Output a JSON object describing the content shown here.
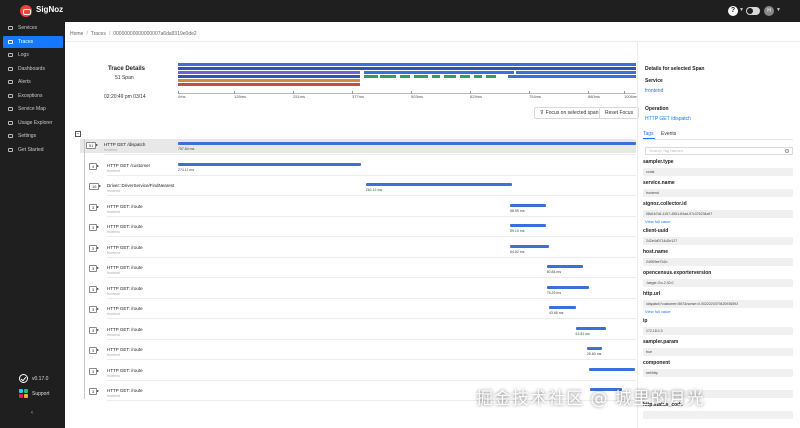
{
  "app": {
    "name": "SigNoz",
    "avatar_initials": "H"
  },
  "sidebar": {
    "items": [
      {
        "label": "Services"
      },
      {
        "label": "Traces",
        "active": true
      },
      {
        "label": "Logs"
      },
      {
        "label": "Dashboards"
      },
      {
        "label": "Alerts"
      },
      {
        "label": "Exceptions"
      },
      {
        "label": "Service Map"
      },
      {
        "label": "Usage Explorer"
      },
      {
        "label": "Settings"
      },
      {
        "label": "Get Started"
      }
    ],
    "version": "v0.17.0",
    "support": "Support"
  },
  "breadcrumb": [
    "Home",
    "Traces",
    "00000000000000007a6da9319e0de2"
  ],
  "trace": {
    "title": "Trace Details",
    "span_count": "51 Span",
    "start_time": "02:20:49 pm 03/14",
    "ticks": [
      "0ms",
      "126ms",
      "251ms",
      "377ms",
      "503ms",
      "629ms",
      "754ms",
      "880ms",
      "1006ms",
      "1.13s"
    ],
    "focus_button": "Focus on selected span",
    "reset_button": "Reset Focus",
    "rows": [
      {
        "count": "51",
        "name": "HTTP GET /dispatch",
        "service": "frontend",
        "duration": "757.84 ms",
        "start": 0,
        "width": 1.0
      },
      {
        "count": "4",
        "name": "HTTP GET /customer",
        "service": "frontend",
        "duration": "274.11 ms",
        "start": 0,
        "width": 0.4
      },
      {
        "count": "16",
        "name": "Driver::DriverService/FindNearest",
        "service": "frontend",
        "duration": "262.12 ms",
        "start": 0.41,
        "width": 0.32
      },
      {
        "count": "3",
        "name": "HTTP GET: /route",
        "service": "frontend",
        "duration": "58.95 ms",
        "start": 0.725,
        "width": 0.078
      },
      {
        "count": "3",
        "name": "HTTP GET: /route",
        "service": "frontend",
        "duration": "59.10 ms",
        "start": 0.725,
        "width": 0.078
      },
      {
        "count": "3",
        "name": "HTTP GET: /route",
        "service": "frontend",
        "duration": "64.62 ms",
        "start": 0.725,
        "width": 0.085
      },
      {
        "count": "3",
        "name": "HTTP GET: /route",
        "service": "frontend",
        "duration": "60.84 ms",
        "start": 0.805,
        "width": 0.08
      },
      {
        "count": "3",
        "name": "HTTP GET: /route",
        "service": "frontend",
        "duration": "75.29 ms",
        "start": 0.805,
        "width": 0.093
      },
      {
        "count": "3",
        "name": "HTTP GET: /route",
        "service": "frontend",
        "duration": "43.68 ms",
        "start": 0.81,
        "width": 0.058
      },
      {
        "count": "3",
        "name": "HTTP GET: /route",
        "service": "frontend",
        "duration": "61.81 ms",
        "start": 0.868,
        "width": 0.066
      },
      {
        "count": "3",
        "name": "HTTP GET: /route",
        "service": "frontend",
        "duration": "25.60 ms",
        "start": 0.893,
        "width": 0.033
      },
      {
        "count": "3",
        "name": "HTTP GET: /route",
        "service": "frontend",
        "duration": "",
        "start": 0.898,
        "width": 0.1
      },
      {
        "count": "3",
        "name": "HTTP GET: /route",
        "service": "frontend",
        "duration": "",
        "start": 0.9,
        "width": 0.07
      }
    ]
  },
  "details": {
    "title": "Details for selected Span",
    "service_label": "Service",
    "service_value": "frontend",
    "operation_label": "Operation",
    "operation_value": "HTTP GET /dispatch",
    "tabs": [
      "Tags",
      "Events"
    ],
    "search_placeholder": "Search Tag Names",
    "view_full": "View full value",
    "tags": [
      {
        "key": "sampler.type",
        "value": "const"
      },
      {
        "key": "service.name",
        "value": "frontend"
      },
      {
        "key": "signoz.collector.id",
        "value": "08d1b7c6-1157-4551-84ad-97c376234a97",
        "more": true
      },
      {
        "key": "client-uuid",
        "value": "242e4d0714d2e127"
      },
      {
        "key": "host.name",
        "value": "249f2fee7b1b"
      },
      {
        "key": "opencensus.exporterversion",
        "value": "Jaeger-Go-2.30.0"
      },
      {
        "key": "http.url",
        "value": "/dispatch?customer=567&nonse=0.0022220379420936593",
        "more": true
      },
      {
        "key": "ip",
        "value": "172.18.0.3"
      },
      {
        "key": "sampler.param",
        "value": "true"
      },
      {
        "key": "component",
        "value": "net/http"
      },
      {
        "key": "",
        "value": ""
      },
      {
        "key": "http.status_code",
        "value": ""
      }
    ]
  },
  "watermark": "掘金技术社区 @ 城里的月光",
  "colors": {
    "accent": "#1677ff",
    "span": "#3b6fd9",
    "sidebar": "#1f1f1f"
  }
}
